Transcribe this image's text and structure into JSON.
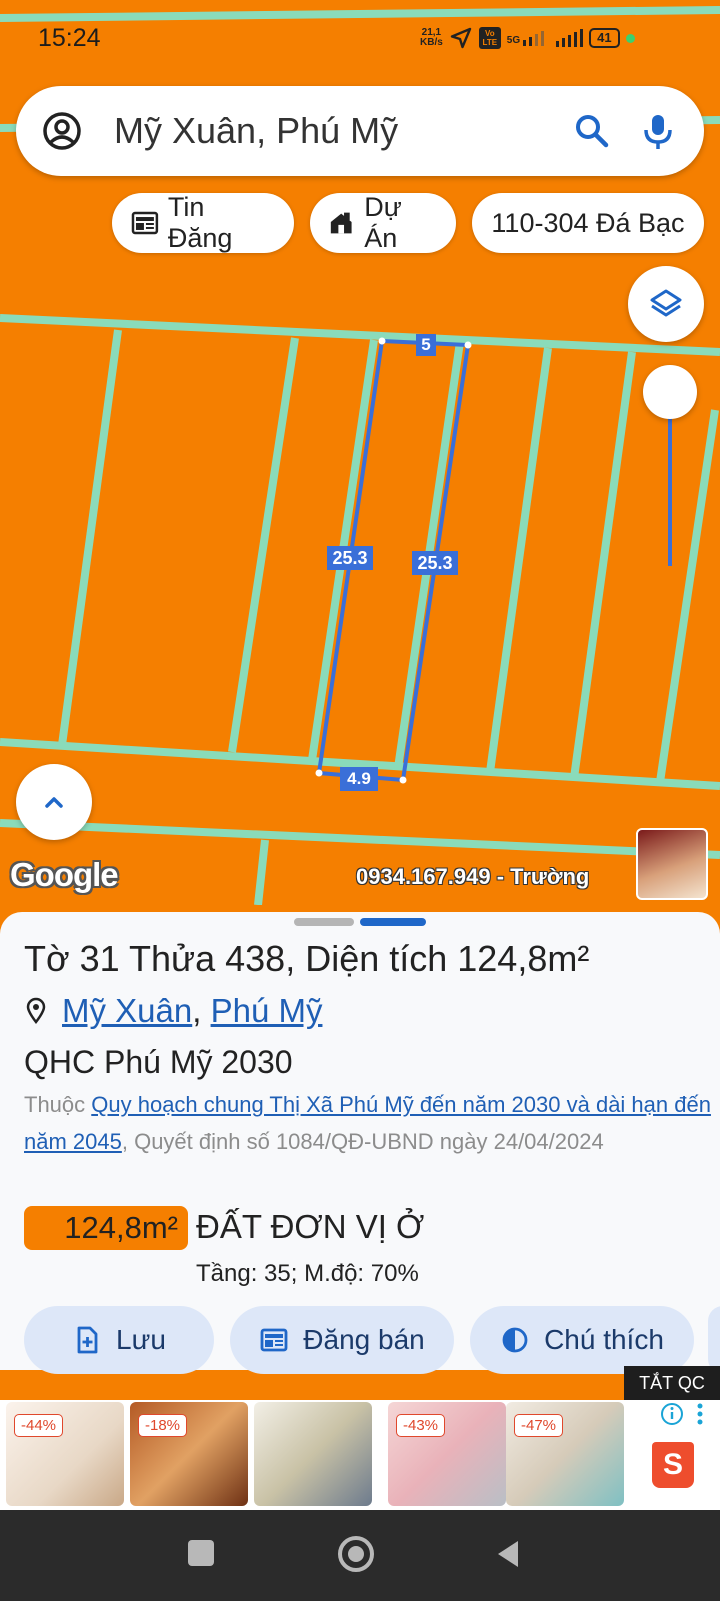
{
  "status_bar": {
    "time": "15:24",
    "net_speed_value": "21,1",
    "net_speed_unit": "KB/s",
    "volte": "Vo LTE",
    "network": "5G",
    "battery": "41"
  },
  "search": {
    "text": "Mỹ Xuân, Phú Mỹ"
  },
  "chips": {
    "listings": "Tin Đăng",
    "projects": "Dự Án",
    "road": "110-304 Đá Bạc"
  },
  "map": {
    "dimensions": {
      "top": "5",
      "left": "25.3",
      "right": "25.3",
      "bottom": "4.9"
    },
    "logo": "Google",
    "watermark": "0934.167.949 - Trường"
  },
  "plot": {
    "title": "Tờ 31 Thửa 438, Diện tích 124,8m²",
    "location": {
      "commune": "Mỹ Xuân",
      "separator": ", ",
      "town": "Phú Mỹ"
    },
    "plan_name": "QHC Phú Mỹ 2030",
    "desc_prefix": "Thuộc ",
    "desc_link": "Quy hoạch chung Thị Xã Phú Mỹ đến năm 2030 và dài hạn đến năm 2045",
    "desc_suffix": ", Quyết định số 1084/QĐ-UBND ngày 24/04/2024",
    "area": "124,8m²",
    "land_use": "ĐẤT ĐƠN VỊ Ở",
    "density": "Tầng: 35; M.độ: 70%"
  },
  "actions": {
    "save": "Lưu",
    "post_sale": "Đăng bán",
    "legend": "Chú thích"
  },
  "ads": {
    "turn_off": "TẮT QC",
    "discounts": [
      "-44%",
      "-18%",
      "-43%",
      "-47%"
    ],
    "shopee_letter": "S"
  }
}
